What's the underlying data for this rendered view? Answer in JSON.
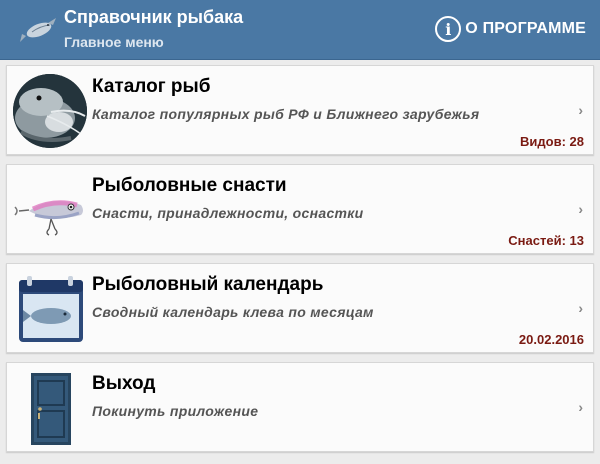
{
  "header": {
    "title": "Справочник рыбака",
    "subtitle": "Главное меню",
    "about_label": "О ПРОГРАММЕ",
    "about_icon": "info-icon",
    "app_icon": "fish-icon"
  },
  "menu": [
    {
      "title": "Каталог рыб",
      "description": "Каталог популярных рыб РФ и Ближнего зарубежья",
      "badge": "Видов: 28",
      "icon": "catfish-icon"
    },
    {
      "title": "Рыболовные снасти",
      "description": "Снасти, принадлежности, оснастки",
      "badge": "Снастей: 13",
      "icon": "lure-icon"
    },
    {
      "title": "Рыболовный календарь",
      "description": "Сводный календарь клева по месяцам",
      "badge": "20.02.2016",
      "icon": "calendar-icon"
    },
    {
      "title": "Выход",
      "description": "Покинуть приложение",
      "badge": "",
      "icon": "door-icon"
    }
  ],
  "chevron": "›",
  "colors": {
    "header_bg": "#4a78a4",
    "badge": "#7a1a12",
    "page_bg": "#ececec"
  }
}
